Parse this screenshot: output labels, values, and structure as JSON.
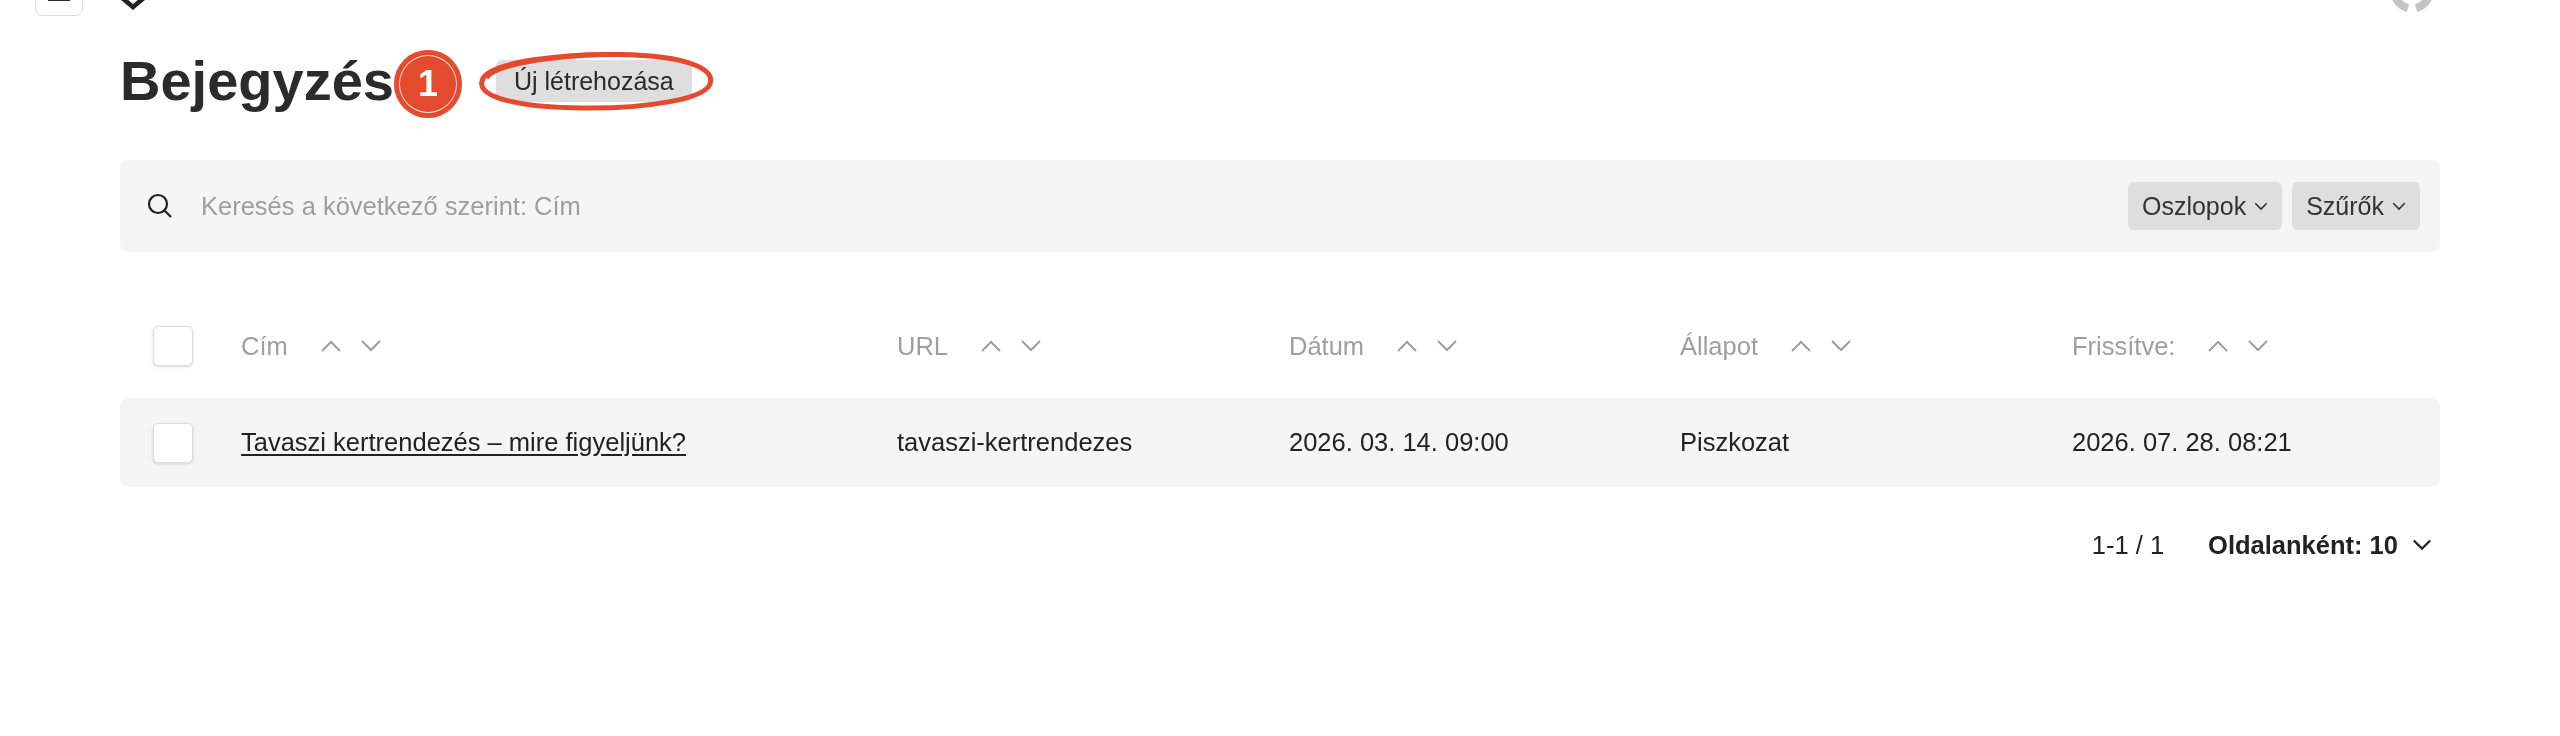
{
  "page": {
    "title": "Bejegyzés",
    "create_button": "Új létrehozása"
  },
  "annotation": {
    "marker": "1"
  },
  "search": {
    "placeholder": "Keresés a következő szerint: Cím"
  },
  "toolbar_buttons": [
    {
      "label": "Oszlopok"
    },
    {
      "label": "Szűrők"
    }
  ],
  "table": {
    "select_all": {
      "checked": false
    },
    "columns": [
      {
        "label": "Cím"
      },
      {
        "label": "URL"
      },
      {
        "label": "Dátum"
      },
      {
        "label": "Állapot"
      },
      {
        "label": "Frissítve:"
      }
    ],
    "rows": [
      {
        "checked": false,
        "cells": [
          "Tavaszi kertrendezés – mire figyeljünk?",
          "tavaszi-kertrendezes",
          "2026. 03. 14. 09:00",
          "Piszkozat",
          "2026. 07. 28. 08:21"
        ]
      }
    ]
  },
  "pagination": {
    "range": "1-1 / 1",
    "per_page": "Oldalanként: 10"
  }
}
